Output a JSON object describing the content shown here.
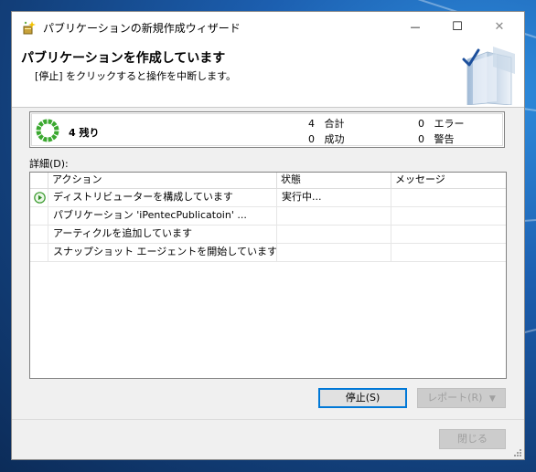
{
  "window": {
    "title": "パブリケーションの新規作成ウィザード",
    "minimize_glyph": "—",
    "maximize_glyph": "☐",
    "close_glyph": "✕"
  },
  "header": {
    "title": "パブリケーションを作成しています",
    "subtitle": "[停止] をクリックすると操作を中断します。"
  },
  "summary": {
    "remaining": "4 残り",
    "total_count": "4",
    "total_label": "合計",
    "success_count": "0",
    "success_label": "成功",
    "error_count": "0",
    "error_label": "エラー",
    "warning_count": "0",
    "warning_label": "警告"
  },
  "details": {
    "label": "詳細(D):",
    "columns": [
      "アクション",
      "状態",
      "メッセージ"
    ],
    "rows": [
      {
        "action": "ディストリビューターを構成しています",
        "status": "実行中...",
        "message": "",
        "icon": "play-icon"
      },
      {
        "action": "パブリケーション 'iPentecPublicatoin' ...",
        "status": "",
        "message": "",
        "icon": ""
      },
      {
        "action": "アーティクルを追加しています",
        "status": "",
        "message": "",
        "icon": ""
      },
      {
        "action": "スナップショット エージェントを開始しています",
        "status": "",
        "message": "",
        "icon": ""
      }
    ]
  },
  "buttons": {
    "stop": "停止(S)",
    "report": "レポート(R)",
    "report_arrow": "▼",
    "close": "閉じる"
  },
  "colors": {
    "spinner": "#3aa82f",
    "accent": "#0078d7"
  }
}
